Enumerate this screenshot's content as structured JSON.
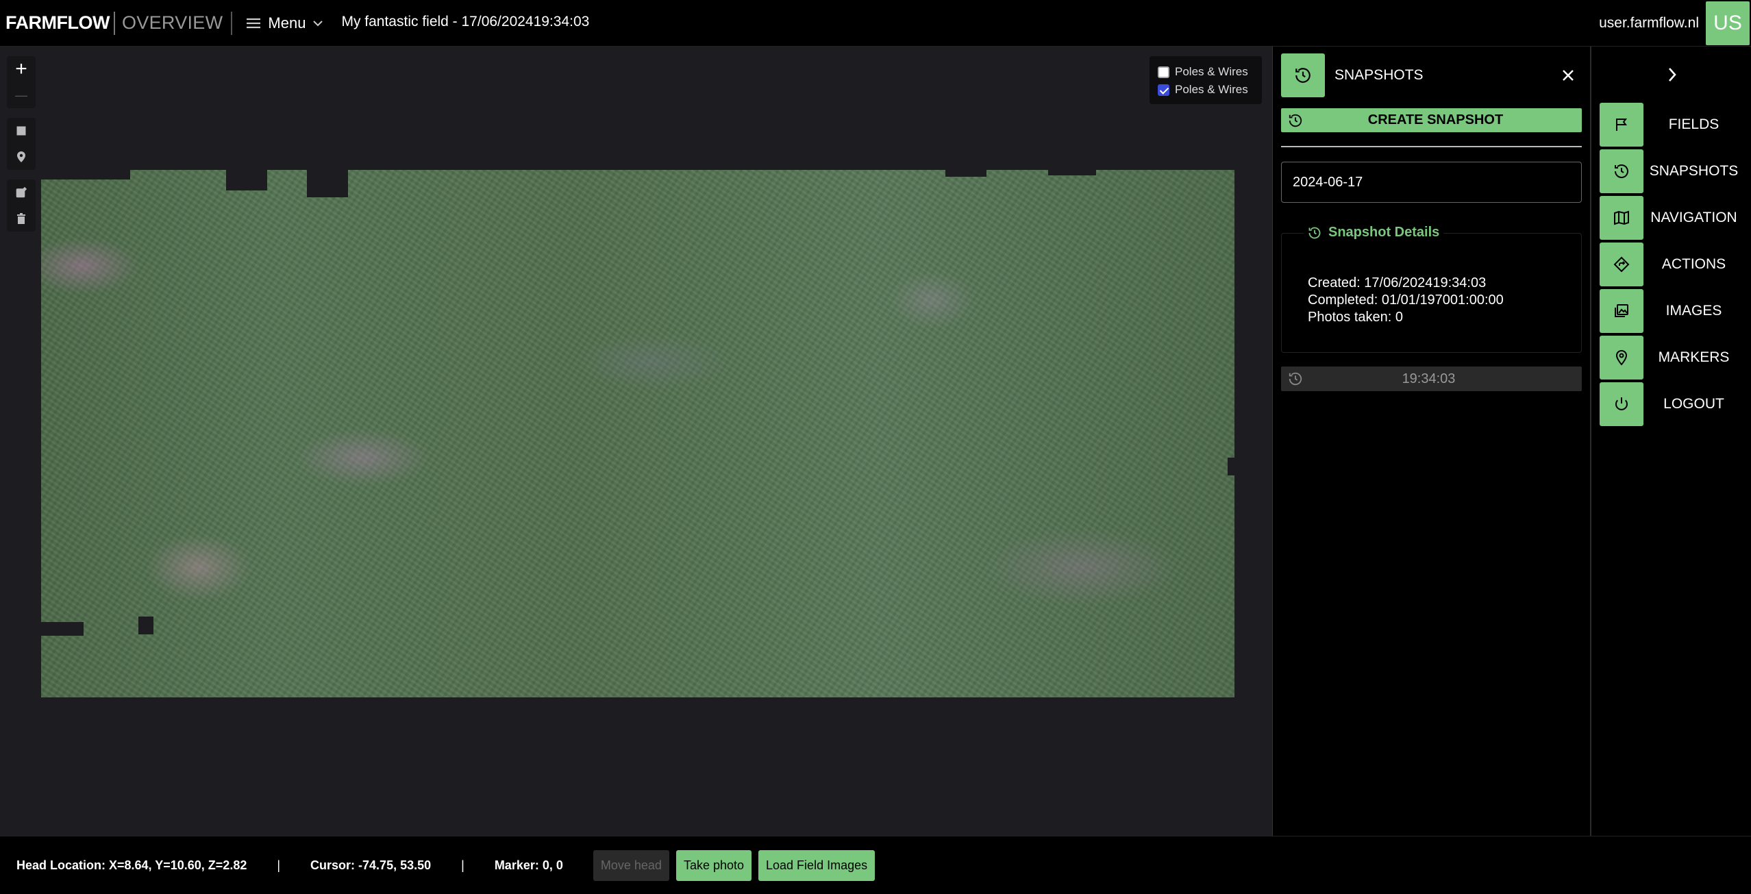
{
  "header": {
    "brand": "FARMFLOW",
    "section": "OVERVIEW",
    "menu_label": "Menu",
    "field_title": "My fantastic field - 17/06/202419:34:03",
    "user_email": "user.farmflow.nl",
    "avatar_initials": "US"
  },
  "map": {
    "zoom_in": "+",
    "zoom_out": "—",
    "layers": [
      {
        "label": "Poles & Wires",
        "checked": false
      },
      {
        "label": "Poles & Wires",
        "checked": true
      }
    ]
  },
  "snapshots_panel": {
    "title": "SNAPSHOTS",
    "create_label": "CREATE SNAPSHOT",
    "date_value": "2024-06-17",
    "details_title": "Snapshot Details",
    "created": "Created: 17/06/202419:34:03",
    "completed": "Completed: 01/01/197001:00:00",
    "photos": "Photos taken: 0",
    "snapshot_time": "19:34:03"
  },
  "nav": {
    "items": [
      {
        "label": "FIELDS",
        "icon": "flag-icon"
      },
      {
        "label": "SNAPSHOTS",
        "icon": "history-icon"
      },
      {
        "label": "NAVIGATION",
        "icon": "map-icon"
      },
      {
        "label": "ACTIONS",
        "icon": "directions-icon"
      },
      {
        "label": "IMAGES",
        "icon": "images-icon"
      },
      {
        "label": "MARKERS",
        "icon": "marker-icon"
      },
      {
        "label": "LOGOUT",
        "icon": "power-icon"
      }
    ]
  },
  "status": {
    "head_location": "Head Location: X=8.64, Y=10.60, Z=2.82",
    "cursor": "Cursor: -74.75, 53.50",
    "marker": "Marker: 0, 0",
    "pipe": "|",
    "move_head": "Move head",
    "take_photo": "Take photo",
    "load_images": "Load Field Images"
  },
  "colors": {
    "accent": "#7ac77e",
    "map_bg": "#1d1c21",
    "checkbox_checked": "#3b4bdc"
  }
}
